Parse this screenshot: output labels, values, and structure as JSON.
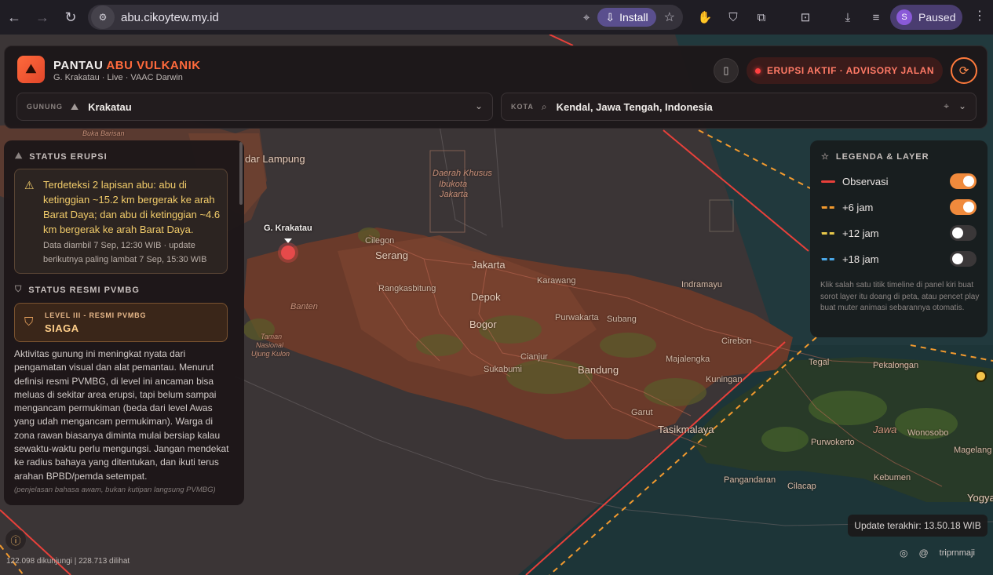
{
  "browser": {
    "url": "abu.cikoytew.my.id",
    "install_label": "Install",
    "profile_initial": "S",
    "profile_status": "Paused"
  },
  "header": {
    "title_main": "PANTAU",
    "title_accent": "ABU VULKANIK",
    "subtitle": "G. Krakatau · Live · VAAC Darwin",
    "alert": "ERUPSI AKTIF · ADVISORY JALAN",
    "gunung_label": "GUNUNG",
    "gunung_value": "Krakatau",
    "kota_label": "KOTA",
    "kota_value": "Kendal, Jawa Tengah, Indonesia"
  },
  "status_erupsi": {
    "title": "STATUS ERUPSI",
    "message": "Terdeteksi 2 lapisan abu: abu di ketinggian ~15.2 km bergerak ke arah Barat Daya; dan abu di ketinggian ~4.6 km bergerak ke arah Barat Daya.",
    "meta": "Data diambil 7 Sep, 12:30 WIB · update berikutnya paling lambat 7 Sep, 15:30 WIB"
  },
  "status_resmi": {
    "title": "STATUS RESMI PVMBG",
    "level_small": "LEVEL III - RESMI PVMBG",
    "level_name": "SIAGA",
    "description": "Aktivitas gunung ini meningkat nyata dari pengamatan visual dan alat pemantau. Menurut definisi resmi PVMBG, di level ini ancaman bisa meluas di sekitar area erupsi, tapi belum sampai mengancam permukiman (beda dari level Awas yang udah mengancam permukiman). Warga di zona rawan biasanya diminta mulai bersiap kalau sewaktu-waktu perlu mengungsi. Jangan mendekat ke radius bahaya yang ditentukan, dan ikuti terus arahan BPBD/pemda setempat.",
    "note": "(penjelasan bahasa awam, bukan kutipan langsung PVMBG)"
  },
  "legend": {
    "title": "LEGENDA & LAYER",
    "items": [
      {
        "label": "Observasi",
        "color": "#e8403a",
        "dashed": false,
        "on": true
      },
      {
        "label": "+6 jam",
        "color": "#f29a2e",
        "dashed": true,
        "on": true
      },
      {
        "label": "+12 jam",
        "color": "#e8c84a",
        "dashed": true,
        "on": false
      },
      {
        "label": "+18 jam",
        "color": "#4aa8e8",
        "dashed": true,
        "on": false
      }
    ],
    "hint": "Klik salah satu titik timeline di panel kiri buat sorot layer itu doang di peta, atau pencet play buat muter animasi sebarannya otomatis."
  },
  "map": {
    "volcano_label": "G. Krakatau",
    "labels": {
      "bandar_lampung": "dar Lampung",
      "buka_barisan": "Buka Barisan",
      "daerah_khusus": "Daerah Khusus",
      "ibukota": "Ibukota",
      "jakarta_region": "Jakarta",
      "cilegon": "Cilegon",
      "serang": "Serang",
      "jakarta": "Jakarta",
      "rangkasbitung": "Rangkasbitung",
      "depok": "Depok",
      "karawang": "Karawang",
      "indramayu": "Indramayu",
      "bogor": "Bogor",
      "purwakarta": "Purwakarta",
      "subang": "Subang",
      "banten": "Banten",
      "taman": "Taman",
      "nasional": "Nasional",
      "ujung_kulon": "Ujung Kulon",
      "cirebon": "Cirebon",
      "cianjur": "Cianjur",
      "sukabumi": "Sukabumi",
      "bandung": "Bandung",
      "majalengka": "Majalengka",
      "kuningan": "Kuningan",
      "tegal": "Tegal",
      "pekalongan": "Pekalongan",
      "garut": "Garut",
      "tasikmalaya": "Tasikmalaya",
      "jawa": "Jawa",
      "wonosobo": "Wonosobo",
      "purwokerto": "Purwokerto",
      "magelang": "Magelang",
      "kebumen": "Kebumen",
      "pangandaran": "Pangandaran",
      "cilacap": "Cilacap",
      "yogya": "Yogya"
    }
  },
  "footer": {
    "update": "Update terakhir: 13.50.18 WIB",
    "visitors": "122.098 dikunjungi | 228.713 dilihat",
    "handle": "triprnmaji"
  }
}
